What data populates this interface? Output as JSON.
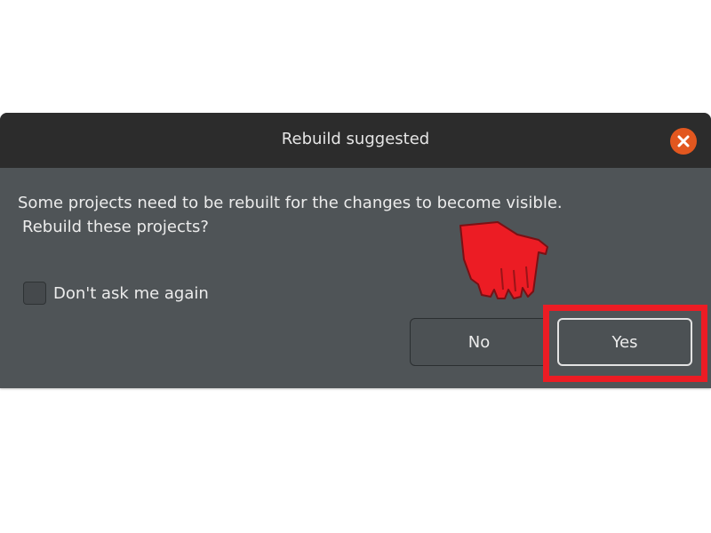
{
  "dialog": {
    "title": "Rebuild suggested",
    "message_line1": "Some projects need to be rebuilt for the changes to become visible.",
    "message_line2": "Rebuild these projects?",
    "checkbox_label": "Don't ask me again",
    "checkbox_checked": false,
    "buttons": {
      "no_label": "No",
      "yes_label": "Yes"
    },
    "close_icon": "close-icon"
  },
  "annotation": {
    "highlight_color": "#ec1c24",
    "pointer_icon": "hand-pointer-icon"
  },
  "colors": {
    "titlebar": "#2c2c2c",
    "body": "#4f5457",
    "close_button": "#e2571f",
    "text": "#ececec"
  }
}
